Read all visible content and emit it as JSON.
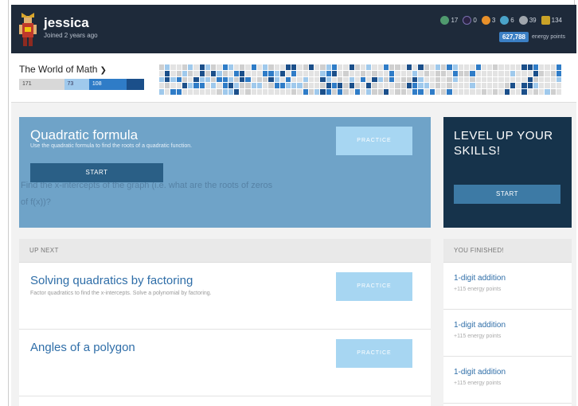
{
  "user": {
    "name": "jessica",
    "joined": "Joined 2 years ago",
    "badges": [
      {
        "icon": "meteorite-badge-icon",
        "color": "#4f9a6e",
        "count": "17"
      },
      {
        "icon": "black-hole-badge-icon",
        "color": "#2b2344",
        "count": "0"
      },
      {
        "icon": "sun-badge-icon",
        "color": "#e8902a",
        "count": "3"
      },
      {
        "icon": "earth-badge-icon",
        "color": "#4aa3c9",
        "count": "6"
      },
      {
        "icon": "moon-badge-icon",
        "color": "#a0a6ad",
        "count": "39"
      },
      {
        "icon": "challenge-patch-icon",
        "color": "#c9a227",
        "count": "134"
      }
    ],
    "energy_points": "627,788",
    "energy_label": "energy points"
  },
  "mission": {
    "title": "The World of Math",
    "progress": [
      {
        "value": "171",
        "fraction": 0.36
      },
      {
        "value": "73",
        "fraction": 0.2
      },
      {
        "value": "108",
        "fraction": 0.3
      },
      {
        "value": "",
        "fraction": 0.14
      }
    ]
  },
  "hero": {
    "title": "Quadratic formula",
    "description": "Use the quadratic formula to find the roots of a quadratic function.",
    "start_label": "START",
    "practice_label": "PRACTICE",
    "ghost_line1": "Find the x-intercepts of the graph (i.e. what are the roots of zeros",
    "ghost_line2": "of f(x))?"
  },
  "level_up": {
    "title_line1": "LEVEL UP YOUR",
    "title_line2": "SKILLS!",
    "start_label": "START"
  },
  "up_next": {
    "heading": "UP NEXT",
    "items": [
      {
        "title": "Solving quadratics by factoring",
        "description": "Factor quadratics to find the x-intercepts. Solve a polynomial by factoring.",
        "practice_label": "PRACTICE"
      },
      {
        "title": "Angles of a polygon",
        "description": "",
        "practice_label": "PRACTICE"
      }
    ]
  },
  "finished": {
    "heading": "YOU FINISHED!",
    "items": [
      {
        "title": "1-digit addition",
        "points": "+115 energy points"
      },
      {
        "title": "1-digit addition",
        "points": "+115 energy points"
      },
      {
        "title": "1-digit addition",
        "points": "+115 energy points"
      }
    ]
  }
}
